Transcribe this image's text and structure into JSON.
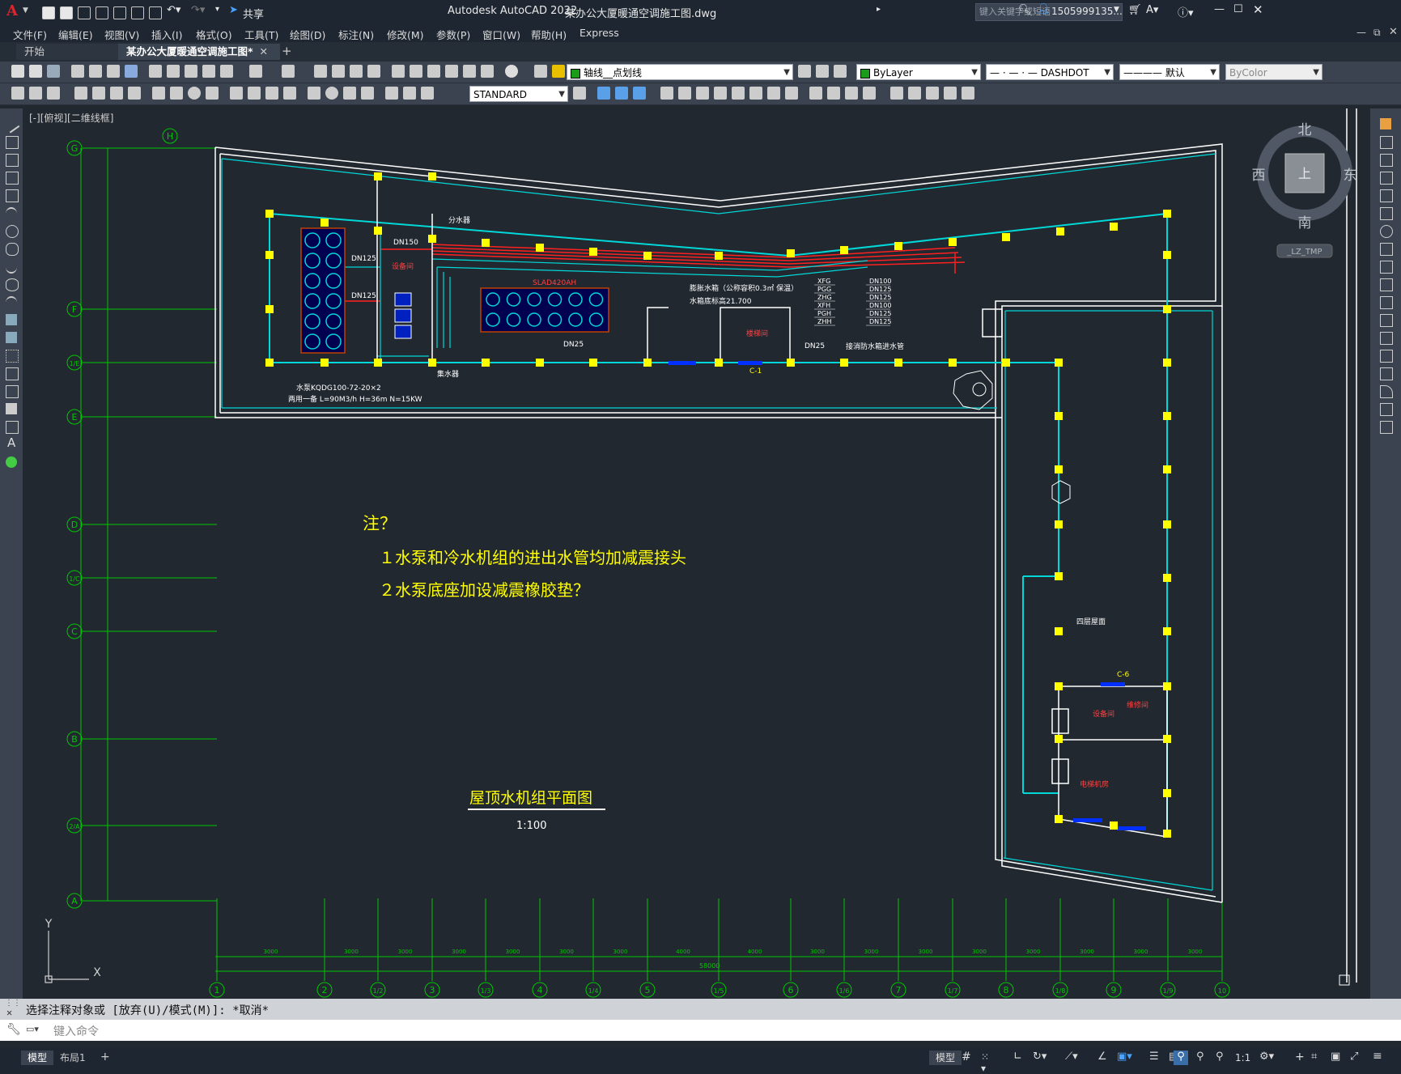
{
  "app": {
    "title": "Autodesk AutoCAD 2022",
    "filename": "某办公大厦暖通空调施工图.dwg",
    "share_label": "共享",
    "search_placeholder": "键入关键字或短语",
    "user": "1505999135...",
    "logo_letter": "A"
  },
  "menu": [
    "文件(F)",
    "编辑(E)",
    "视图(V)",
    "插入(I)",
    "格式(O)",
    "工具(T)",
    "绘图(D)",
    "标注(N)",
    "修改(M)",
    "参数(P)",
    "窗口(W)",
    "帮助(H)",
    "Express"
  ],
  "tabs": [
    {
      "label": "开始",
      "active": false
    },
    {
      "label": "某办公大厦暖通空调施工图*",
      "active": true
    }
  ],
  "toolbar": {
    "layer": "轴线__点划线",
    "color": "ByLayer",
    "linetype": "DASHDOT",
    "lineweight": "默认",
    "plotstyle": "ByColor",
    "textstyle": "STANDARD"
  },
  "viewport": {
    "label": "[-][俯视][二维线框]",
    "compass": {
      "north": "北",
      "south": "南",
      "east": "东",
      "west": "西",
      "top": "上"
    },
    "ucs_label": "_LZ_TMP",
    "axis_y": "Y",
    "axis_x": "X"
  },
  "drawing": {
    "notes_title": "注？",
    "note1": "１水泵和冷水机组的进出水管均加减震接头",
    "note2": "２水泵底座加设减震橡胶垫？",
    "plan_title": "屋顶水机组平面图",
    "scale": "1:100",
    "grid_h": "H",
    "grid_rows": [
      "G",
      "F",
      "1/E",
      "E",
      "D",
      "1/C",
      "C",
      "B",
      "2/A",
      "A"
    ],
    "grid_cols": [
      "1",
      "2",
      "1/2",
      "3",
      "1/3",
      "4",
      "1/4",
      "5",
      "1/5",
      "6",
      "1/6",
      "7",
      "1/7",
      "8",
      "1/8",
      "9",
      "1/9",
      "10"
    ],
    "dims": [
      "3000",
      "3000",
      "3000",
      "3000",
      "3000",
      "3000",
      "3000",
      "4000",
      "4000",
      "3000",
      "3000",
      "3000",
      "3000",
      "3000",
      "3000",
      "3000",
      "3000"
    ],
    "total_dim": "58000",
    "labels": {
      "distributor": "分水器",
      "collector": "集水器",
      "equipment_room": "设备间",
      "elevator_room": "楼梯间",
      "chiller": "SLAD420AH",
      "pump_spec1": "水泵KQDG100-72-20×2",
      "pump_spec2": "两用一备 L=90M3/h H=36m N=15KW",
      "expansion_tank1": "膨胀水箱（公称容积0.3㎡ 保温）",
      "expansion_tank2": "水箱底标高21.700",
      "fire_pipe": "接消防水箱进水管",
      "roof_label": "四层屋面",
      "equipment_room2": "设备间",
      "repair_room": "维修间",
      "elevator_machine": "电梯机房",
      "window_c1": "C-1",
      "window_c6": "C-6",
      "dn150": "DN150",
      "dn125a": "DN125",
      "dn125b": "DN125",
      "dn25a": "DN25",
      "dn25b": "DN25",
      "pipe_list_left": [
        "XFG",
        "PGG",
        "ZHG",
        "XFH",
        "PGH",
        "ZHH"
      ],
      "pipe_list_right": [
        "DN100",
        "DN125",
        "DN125",
        "DN100",
        "DN125",
        "DN125"
      ]
    }
  },
  "command": {
    "history": "选择注释对象或 [放弃(U)/模式(M)]: *取消*",
    "placeholder": "键入命令"
  },
  "status": {
    "tabs": [
      "模型",
      "布局1"
    ],
    "model_label": "模型",
    "scale": "1:1"
  },
  "colors": {
    "background": "#212830",
    "grid": "#00c800",
    "cyan": "#00d8d8",
    "yellow": "#ffff00",
    "red": "#ff2020",
    "white": "#ffffff"
  }
}
